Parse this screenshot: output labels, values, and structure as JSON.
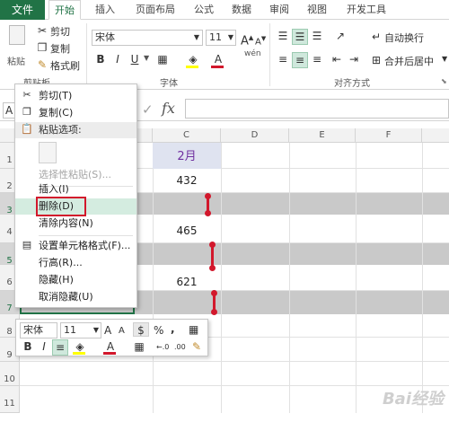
{
  "tabs": {
    "file": "文件",
    "items": [
      "开始",
      "插入",
      "页面布局",
      "公式",
      "数据",
      "审阅",
      "视图",
      "开发工具"
    ]
  },
  "ribbon": {
    "clipboard": {
      "paste": "粘贴",
      "cut": "剪切",
      "copy": "复制",
      "format_painter": "格式刷",
      "group": "剪贴板"
    },
    "font": {
      "name": "宋体",
      "size": "11",
      "bold": "B",
      "italic": "I",
      "underline": "U",
      "group": "字体",
      "grow": "A",
      "shrink": "A",
      "color_a": "A",
      "wen": "wén"
    },
    "alignment": {
      "wrap": "自动换行",
      "merge": "合并后居中",
      "group": "对齐方式"
    }
  },
  "formula_bar": {
    "name_box": "A",
    "fx": "fx"
  },
  "columns": [
    "C",
    "D",
    "E",
    "F"
  ],
  "rows": [
    "1",
    "2",
    "3",
    "4",
    "5",
    "6",
    "7",
    "8",
    "9",
    "10",
    "11"
  ],
  "cells": {
    "header": "2月",
    "r2": "432",
    "r4": "465",
    "r6": "621"
  },
  "context_menu": {
    "cut": "剪切(T)",
    "copy": "复制(C)",
    "paste_header": "粘贴选项:",
    "paste_special": "选择性粘贴(S)...",
    "insert": "插入(I)",
    "delete": "删除(D)",
    "clear": "清除内容(N)",
    "format_cells": "设置单元格格式(F)...",
    "row_height": "行高(R)...",
    "hide": "隐藏(H)",
    "unhide": "取消隐藏(U)"
  },
  "mini_toolbar": {
    "font": "宋体",
    "size": "11",
    "bold": "B",
    "italic": "I",
    "percent": "%",
    "comma": ",",
    "color_a": "A",
    "grow": "A",
    "shrink": "A",
    "inc_dec": "←.0",
    "dec_dec": ".00"
  },
  "colors": {
    "excel_green": "#217346",
    "highlight": "#d4ece0",
    "red": "#d2182c",
    "band": "#c9c9c9",
    "header_purple": "#7030a0"
  },
  "watermark": "Bai经验"
}
